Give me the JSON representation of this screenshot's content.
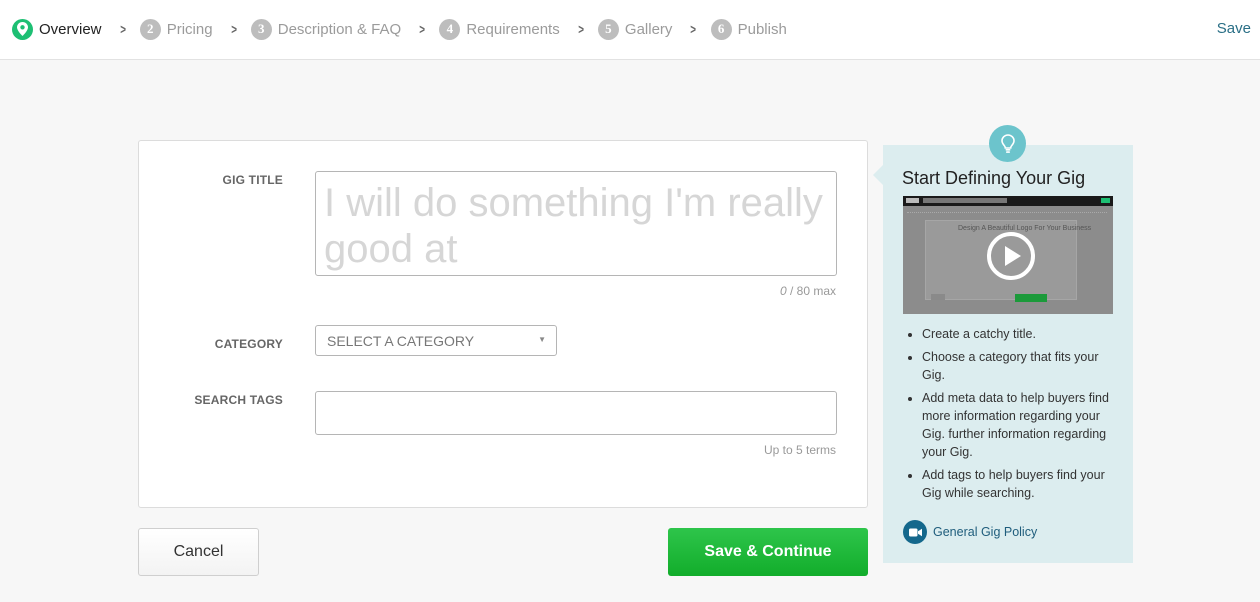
{
  "nav": {
    "steps": [
      {
        "num": "",
        "label": "Overview",
        "active": true,
        "icon": "location-pin-icon"
      },
      {
        "num": "2",
        "label": "Pricing"
      },
      {
        "num": "3",
        "label": "Description & FAQ"
      },
      {
        "num": "4",
        "label": "Requirements"
      },
      {
        "num": "5",
        "label": "Gallery"
      },
      {
        "num": "6",
        "label": "Publish"
      }
    ],
    "save_label": "Save"
  },
  "form": {
    "gig_title": {
      "label": "GIG TITLE",
      "value": "",
      "placeholder": "I will do something I'm really good at",
      "count_current": "0",
      "count_suffix": " / 80 max"
    },
    "category": {
      "label": "CATEGORY",
      "selected": "SELECT A CATEGORY"
    },
    "search_tags": {
      "label": "SEARCH TAGS",
      "value": "",
      "hint": "Up to 5 terms"
    }
  },
  "buttons": {
    "cancel": "Cancel",
    "save_continue": "Save & Continue"
  },
  "panel": {
    "title": "Start Defining Your Gig",
    "video_preview_text": "Design A Beautiful Logo For Your Business",
    "tips": [
      "Create a catchy title.",
      "Choose a category that fits your Gig.",
      "Add meta data to help buyers find more information regarding your Gig. further information regarding your Gig.",
      "Add tags to help buyers find your Gig while searching."
    ],
    "policy_link": "General Gig Policy"
  },
  "colors": {
    "accent_green": "#1dbf73",
    "button_green": "#1fb73a",
    "link_blue": "#2a6f86",
    "panel_bg": "#dcedef",
    "bulb_teal": "#6cc4cc"
  }
}
